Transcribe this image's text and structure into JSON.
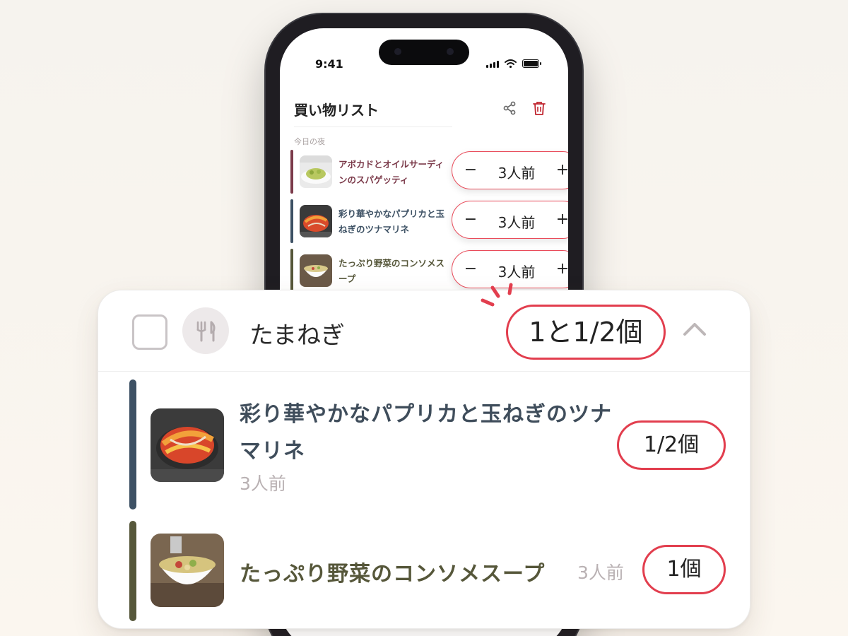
{
  "status_bar": {
    "time": "9:41"
  },
  "app": {
    "title": "買い物リスト"
  },
  "colors": {
    "accent": "#e23e4e",
    "recipe_1_accent": "#7b3a4a",
    "recipe_2_accent": "#3d5164",
    "recipe_3_accent": "#56573a"
  },
  "icons": [
    "share-icon",
    "trash-icon",
    "utensils-icon",
    "chevron-up-icon",
    "plus-icon",
    "minus-icon"
  ],
  "meal_plan": {
    "section_label": "今日の夜",
    "recipes": [
      {
        "name": "アボカドとオイルサーディンのスパゲッティ",
        "servings": "3人前",
        "minus": "−",
        "plus": "+"
      },
      {
        "name": "彩り華やかなパプリカと玉ねぎのツナマリネ",
        "servings": "3人前",
        "minus": "−",
        "plus": "+"
      },
      {
        "name": "たっぷり野菜のコンソメスープ",
        "servings": "3人前",
        "minus": "−",
        "plus": "+"
      }
    ]
  },
  "ingredient": {
    "name": "たまねぎ",
    "total": "1と1/2個",
    "checked": false,
    "usages": [
      {
        "recipe": "彩り華やかなパプリカと玉ねぎのツナマリネ",
        "servings": "3人前",
        "amount": "1/2個"
      },
      {
        "recipe": "たっぷり野菜のコンソメスープ",
        "servings": "3人前",
        "amount": "1個"
      }
    ]
  }
}
